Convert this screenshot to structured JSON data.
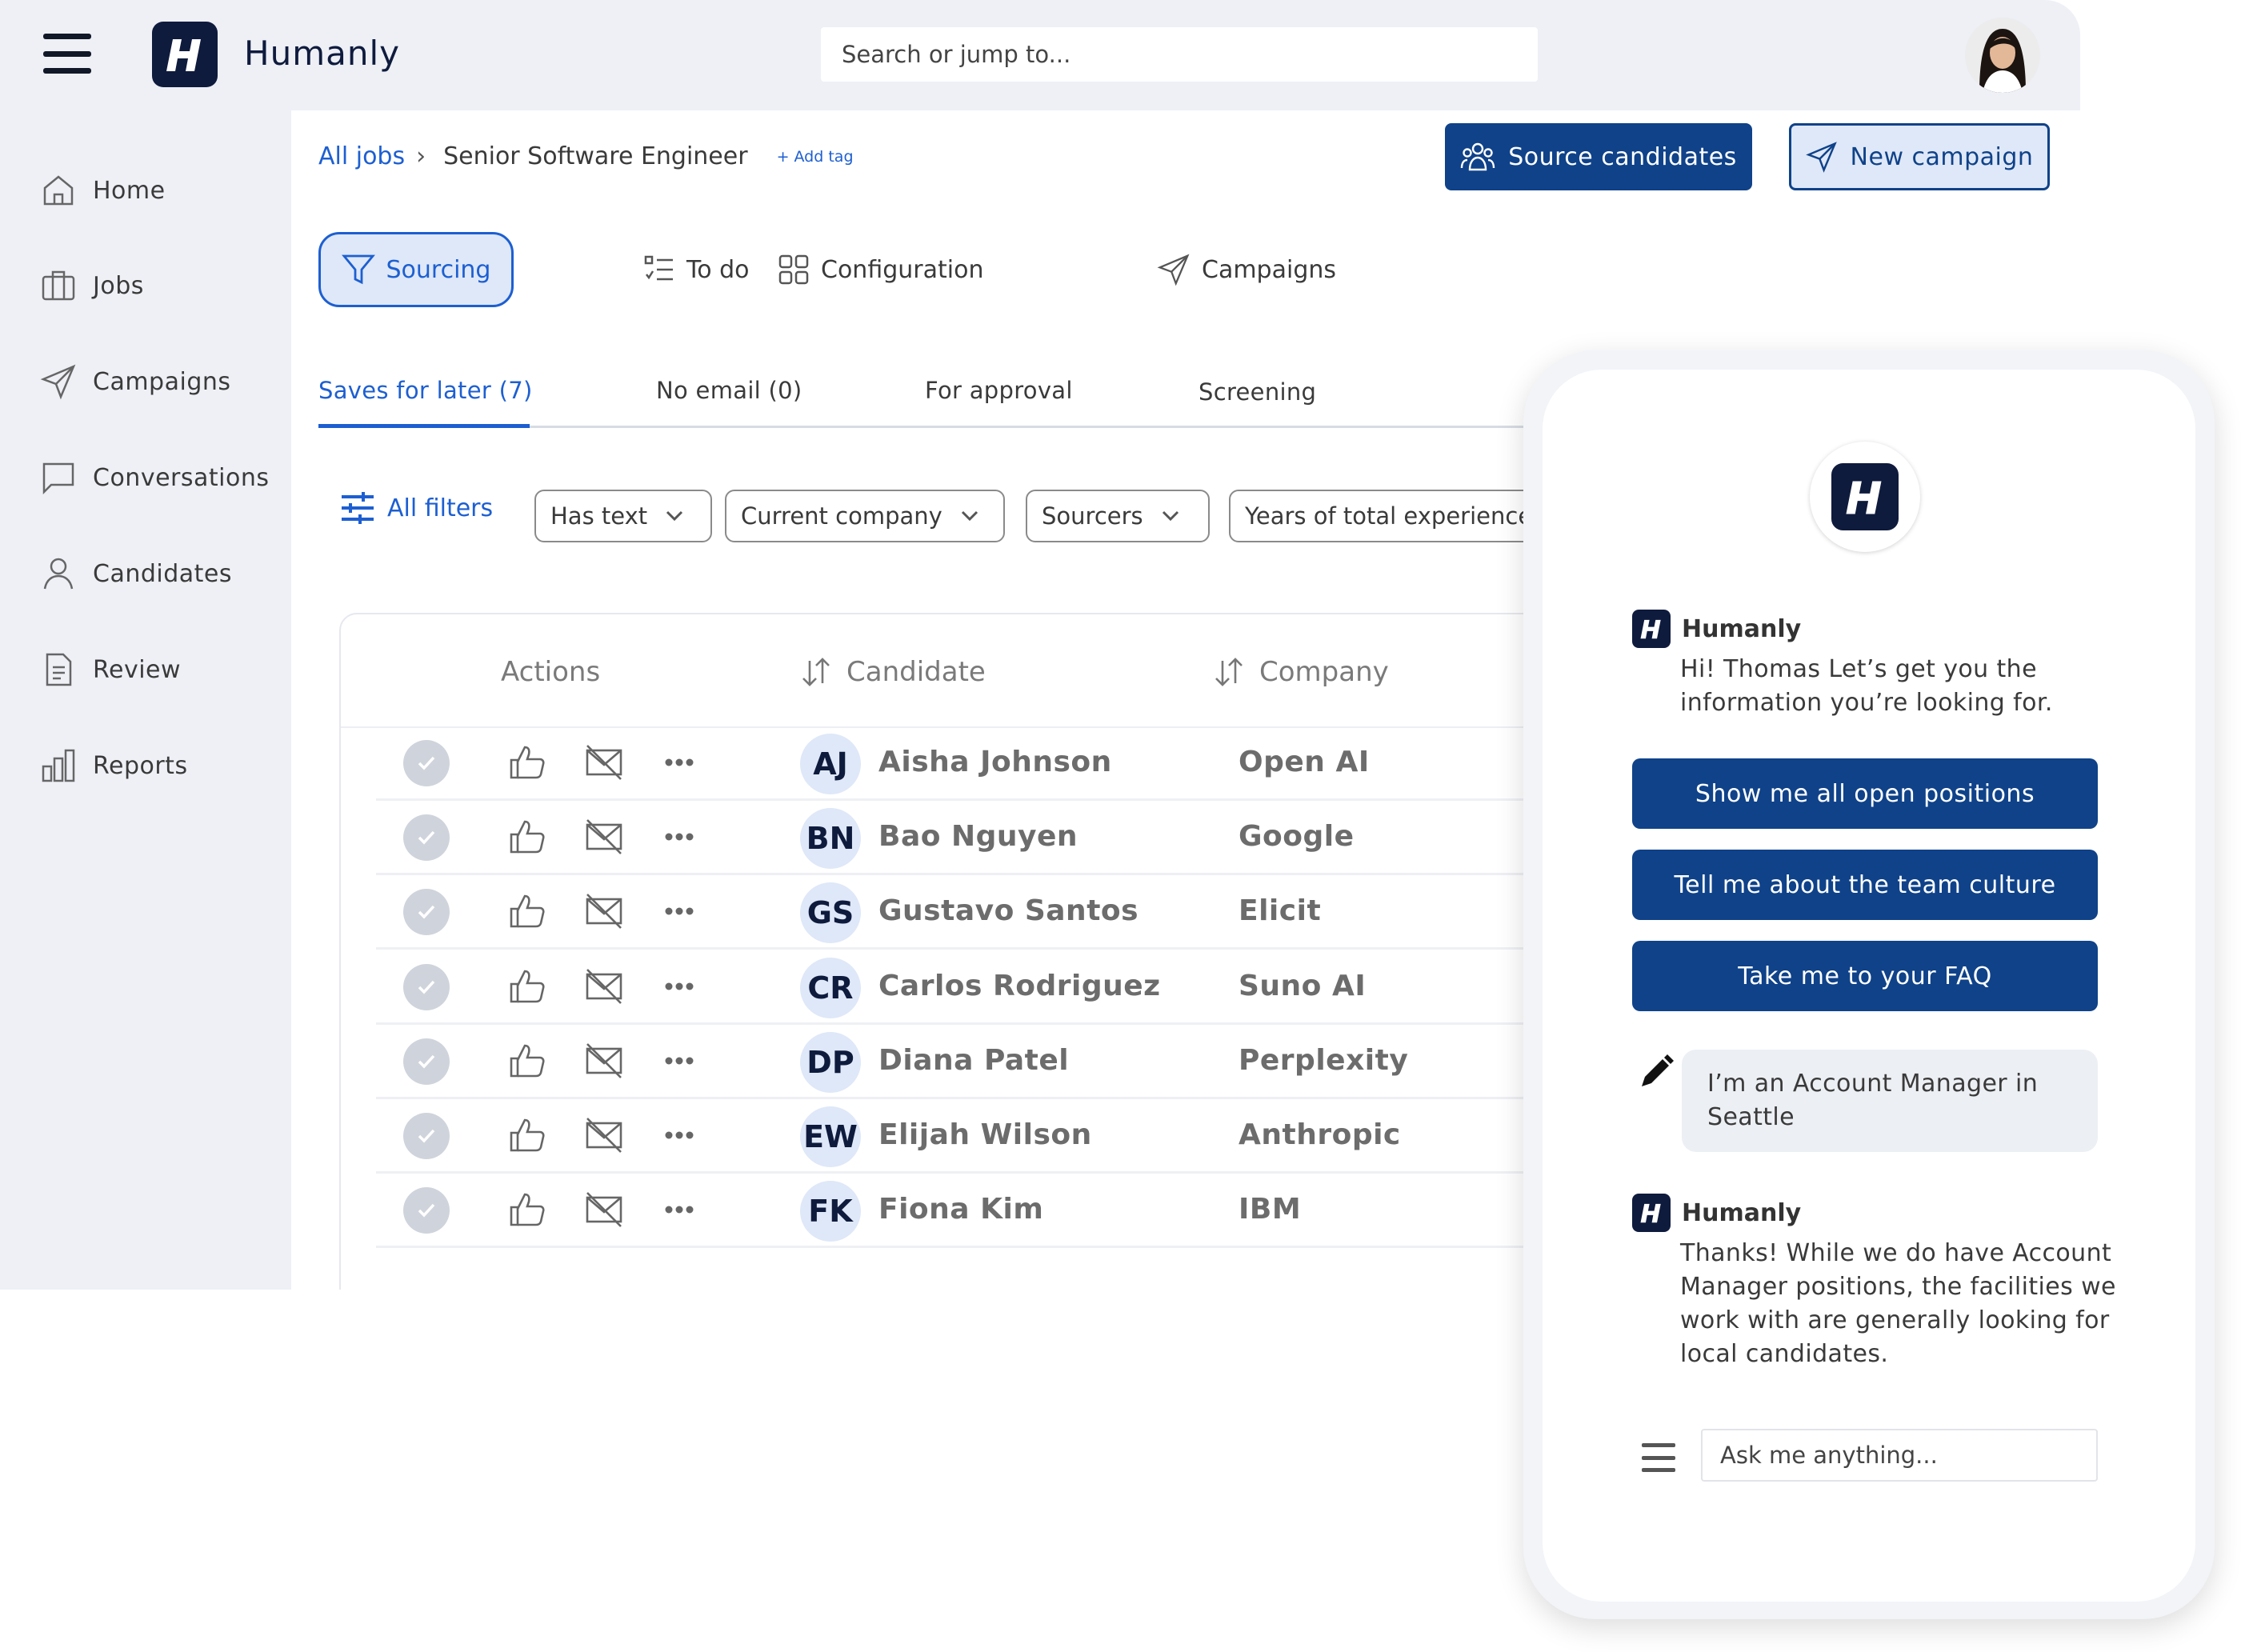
{
  "app": {
    "name": "Humanly",
    "logo_letter": "H"
  },
  "search": {
    "placeholder": "Search or jump to..."
  },
  "sidebar": {
    "items": [
      {
        "label": "Home",
        "icon": "home-icon"
      },
      {
        "label": "Jobs",
        "icon": "briefcase-icon"
      },
      {
        "label": "Campaigns",
        "icon": "send-icon"
      },
      {
        "label": "Conversations",
        "icon": "chat-icon"
      },
      {
        "label": "Candidates",
        "icon": "user-icon"
      },
      {
        "label": "Review",
        "icon": "document-icon"
      },
      {
        "label": "Reports",
        "icon": "bar-chart-icon"
      }
    ]
  },
  "breadcrumb": {
    "root": "All jobs",
    "current": "Senior Software Engineer",
    "add_tag": "+ Add tag"
  },
  "actions": {
    "source": "Source candidates",
    "new_campaign": "New campaign"
  },
  "main_tabs": [
    {
      "label": "Sourcing",
      "icon": "filter-icon",
      "active": true
    },
    {
      "label": "To do",
      "icon": "checklist-icon"
    },
    {
      "label": "Configuration",
      "icon": "grid-icon"
    },
    {
      "label": "Campaigns",
      "icon": "send-icon"
    }
  ],
  "sub_tabs": [
    {
      "label": "Saves for later (7)",
      "active": true
    },
    {
      "label": "No email (0)"
    },
    {
      "label": "For approval"
    },
    {
      "label": "Screening"
    }
  ],
  "filters": {
    "all_label": "All filters",
    "items": [
      "Has text",
      "Current company",
      "Sourcers",
      "Years of total experience"
    ]
  },
  "table": {
    "columns": {
      "actions": "Actions",
      "candidate": "Candidate",
      "company": "Company"
    },
    "rows": [
      {
        "initials": "AJ",
        "name": "Aisha Johnson",
        "company": "Open AI"
      },
      {
        "initials": "BN",
        "name": "Bao Nguyen",
        "company": "Google"
      },
      {
        "initials": "GS",
        "name": "Gustavo Santos",
        "company": "Elicit"
      },
      {
        "initials": "CR",
        "name": "Carlos Rodriguez",
        "company": "Suno AI"
      },
      {
        "initials": "DP",
        "name": "Diana Patel",
        "company": "Perplexity"
      },
      {
        "initials": "EW",
        "name": "Elijah Wilson",
        "company": "Anthropic"
      },
      {
        "initials": "FK",
        "name": "Fiona Kim",
        "company": "IBM"
      }
    ]
  },
  "chat": {
    "bot_name": "Humanly",
    "greeting": "Hi! Thomas Let’s get you the information you’re looking for.",
    "quick_replies": [
      "Show me all open positions",
      "Tell me about the team culture",
      "Take me to your FAQ"
    ],
    "user_message": "I’m an Account Manager in Seattle",
    "bot_reply": "Thanks! While we do have Account Manager positions, the facilities we work with are generally looking for local candidates.",
    "input_placeholder": "Ask me anything..."
  },
  "colors": {
    "brand_navy": "#0f1b3d",
    "primary_blue": "#0f4289",
    "link_blue": "#1d5fd1",
    "tab_active_bg": "#dfe8f8"
  }
}
